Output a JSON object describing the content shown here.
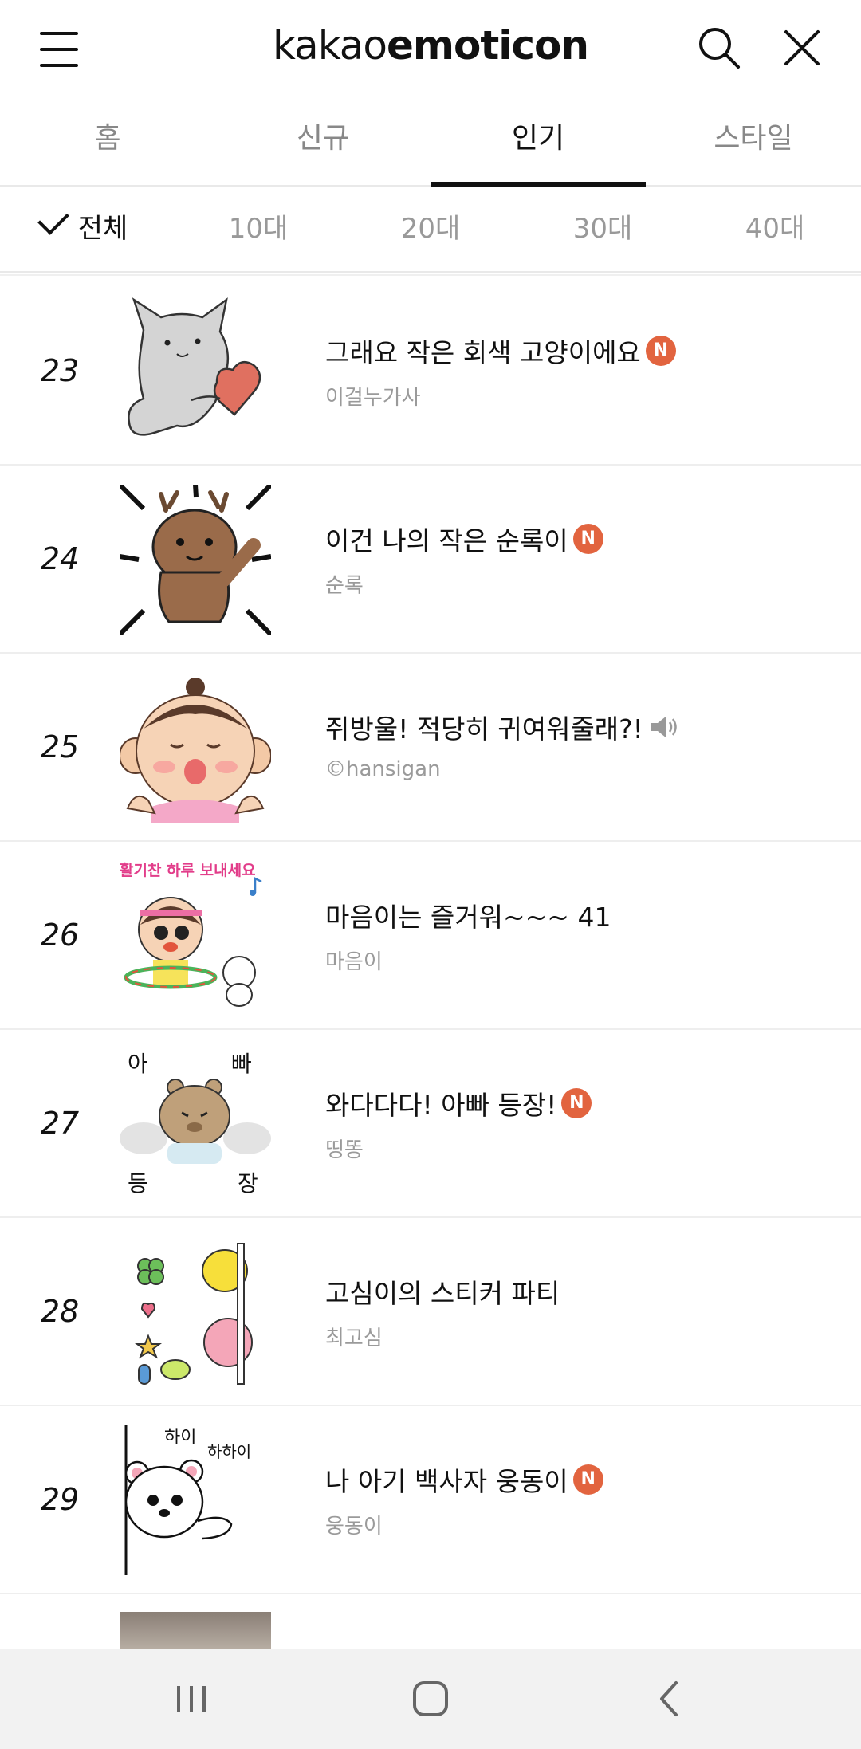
{
  "header": {
    "logo_part1": "kakao",
    "logo_part2": "emoticon",
    "menu_icon": "hamburger-menu-icon",
    "search_icon": "search-icon",
    "close_icon": "close-icon"
  },
  "tabs": [
    {
      "label": "홈",
      "active": false
    },
    {
      "label": "신규",
      "active": false
    },
    {
      "label": "인기",
      "active": true
    },
    {
      "label": "스타일",
      "active": false
    }
  ],
  "age_filters": [
    {
      "label": "전체",
      "active": true
    },
    {
      "label": "10대",
      "active": false
    },
    {
      "label": "20대",
      "active": false
    },
    {
      "label": "30대",
      "active": false
    },
    {
      "label": "40대",
      "active": false
    }
  ],
  "items": [
    {
      "rank": "23",
      "title": "그래요 작은 회색 고양이에요",
      "author": "이걸누가사",
      "badge": "N",
      "thumb": "gray-cat-with-heart"
    },
    {
      "rank": "24",
      "title": "이건 나의 작은 순록이",
      "author": "순록",
      "badge": "N",
      "thumb": "brown-reindeer"
    },
    {
      "rank": "25",
      "title": "쥐방울! 적당히 귀여워줄래?!",
      "author": "©hansigan",
      "badge": "",
      "thumb": "baby-girl-kiss",
      "sound": true
    },
    {
      "rank": "26",
      "title": "마음이는 즐거워~~~ 41",
      "author": "마음이",
      "badge": "",
      "thumb": "girl-hula-hoop",
      "thumb_caption": "활기찬 하루 보내세요"
    },
    {
      "rank": "27",
      "title": "와다다다! 아빠 등장!",
      "author": "띵똥",
      "badge": "N",
      "thumb": "bear-dad-arrival",
      "thumb_chars": [
        "아",
        "빠",
        "등",
        "장"
      ]
    },
    {
      "rank": "28",
      "title": "고심이의 스티커 파티",
      "author": "최고심",
      "badge": "",
      "thumb": "sticker-party"
    },
    {
      "rank": "29",
      "title": "나 아기 백사자 웅동이",
      "author": "웅동이",
      "badge": "N",
      "thumb": "baby-white-lion",
      "thumb_texts": [
        "하이",
        "하하이"
      ]
    }
  ],
  "colors": {
    "badge": "#e2643f",
    "active_text": "#111111",
    "inactive_text": "#888888",
    "author_text": "#9a9a9a"
  },
  "navbar": {
    "recent_icon": "recent-apps-icon",
    "home_icon": "home-icon",
    "back_icon": "back-icon"
  }
}
